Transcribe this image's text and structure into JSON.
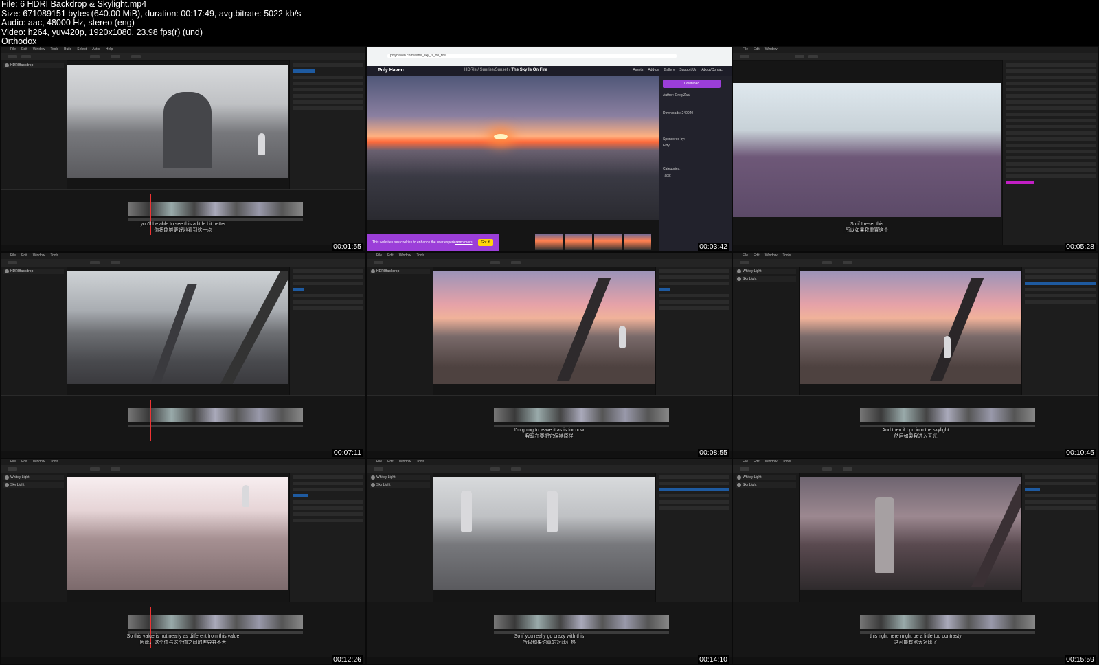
{
  "header": {
    "file": "File: 6 HDRI Backdrop & Skylight.mp4",
    "size": "Size: 671089151 bytes (640.00 MiB), duration: 00:17:49, avg.bitrate: 5022 kb/s",
    "audio": "Audio: aac, 48000 Hz, stereo (eng)",
    "video": "Video: h264, yuv420p, 1920x1080, 23.98 fps(r) (und)",
    "author": "Orthodox"
  },
  "editor": {
    "menu": [
      "File",
      "Edit",
      "Window",
      "Tools",
      "Build",
      "Select",
      "Actor",
      "Help"
    ],
    "outliner_items": [
      "HDRIBackdrop",
      "Whitey Light",
      "Sky Light"
    ]
  },
  "frames": [
    {
      "time": "00:01:55",
      "subtitle_en": "you'll be able to see this a little bit better",
      "subtitle_cn": "你将能够更好地看到这一点"
    },
    {
      "time": "00:03:42",
      "subtitle_en": "",
      "subtitle_cn": ""
    },
    {
      "time": "00:05:28",
      "subtitle_en": "So if I reset this",
      "subtitle_cn": "所以如果我重置这个"
    },
    {
      "time": "00:07:11",
      "subtitle_en": "",
      "subtitle_cn": ""
    },
    {
      "time": "00:08:55",
      "subtitle_en": "I'm going to leave it as is for now",
      "subtitle_cn": "我现在要把它保持原样"
    },
    {
      "time": "00:10:45",
      "subtitle_en": "And then if I go into the skylight",
      "subtitle_cn": "然后如果我进入天光"
    },
    {
      "time": "00:12:26",
      "subtitle_en": "So this value is not nearly as different from this value",
      "subtitle_cn": "因此，这个值与这个值之间的差异并不大"
    },
    {
      "time": "00:14:10",
      "subtitle_en": "So if you really go crazy with this",
      "subtitle_cn": "所以如果你真的对此狂热"
    },
    {
      "time": "00:15:59",
      "subtitle_en": "this right here might be a little too contrasty",
      "subtitle_cn": "这可能有点太对比了"
    }
  ],
  "browser": {
    "url": "polyhaven.com/a/the_sky_is_on_fire",
    "logo": "Poly Haven",
    "breadcrumb": "HDRIs / Sunrise/Sunset / ",
    "page_title": "The Sky Is On Fire",
    "nav": [
      "Assets",
      "Add-on",
      "Gallery",
      "Support Us",
      "About/Contact"
    ],
    "download_label": "Download",
    "author_label": "Author:",
    "author_name": "Greg Zaal",
    "downloads_label": "Downloads: 240040",
    "sponsored_label": "Sponsored by:",
    "sponsor": "Eldy",
    "categories_label": "Categories:",
    "tags_label": "Tags:",
    "cookie_text": "This website uses cookies to enhance the user experience.",
    "cookie_link": "Learn more",
    "cookie_button": "Got it!"
  }
}
